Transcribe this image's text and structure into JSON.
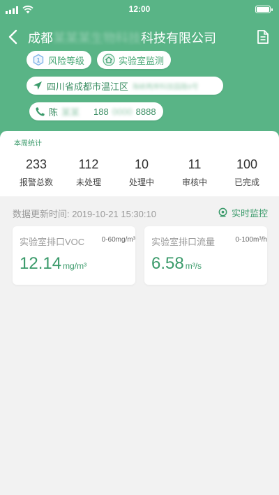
{
  "status_bar": {
    "time": "12:00"
  },
  "header": {
    "title_prefix": "成都",
    "title_masked": "某某某生物科技",
    "title_suffix": "科技有限公司",
    "tags": [
      {
        "badge": "1",
        "label": "风险等级"
      },
      {
        "label": "实验室监测"
      }
    ],
    "address": {
      "visible": "四川省成都市温江区",
      "masked": "海峡两岸科技园路9号"
    },
    "contact": {
      "name_visible": "陈",
      "name_masked": "某某",
      "phone_prefix": "188",
      "phone_masked": "0000",
      "phone_suffix": "8888"
    }
  },
  "weekly_stats": {
    "title": "本周统计",
    "items": [
      {
        "value": "233",
        "label": "报警总数"
      },
      {
        "value": "112",
        "label": "未处理"
      },
      {
        "value": "10",
        "label": "处理中"
      },
      {
        "value": "11",
        "label": "审核中"
      },
      {
        "value": "100",
        "label": "已完成"
      }
    ]
  },
  "update": {
    "label": "数据更新时间:",
    "time": "2019-10-21  15:30:10"
  },
  "realtime_monitor": {
    "label": "实时监控"
  },
  "metrics": [
    {
      "name": "实验室排口VOC",
      "range": "0-60mg/m³",
      "value": "12.14",
      "unit": "mg/m³"
    },
    {
      "name": "实验室排口流量",
      "range": "0-100m³/h",
      "value": "6.58",
      "unit": "m³/s"
    }
  ],
  "colors": {
    "primary": "#59b486",
    "accent_text": "#3a9a6a",
    "background": "#f2f2f2"
  }
}
